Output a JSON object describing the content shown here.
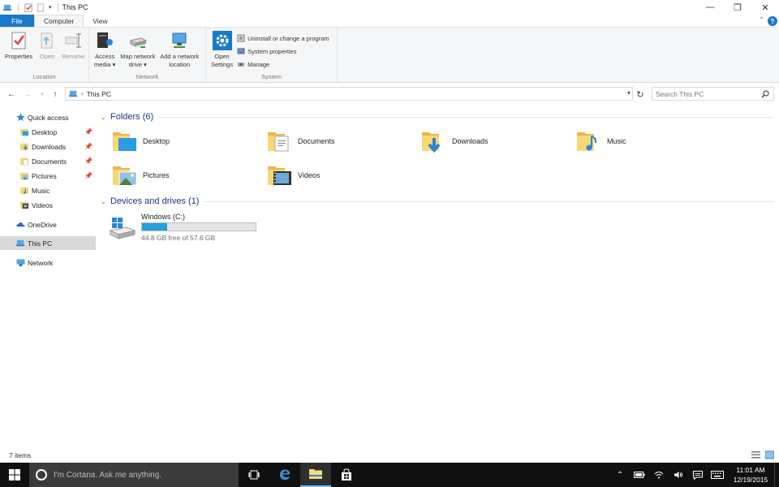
{
  "window": {
    "title": "This PC"
  },
  "tabs": [
    {
      "label": "File"
    },
    {
      "label": "Computer"
    },
    {
      "label": "View"
    }
  ],
  "ribbon": {
    "location": {
      "label": "Location",
      "properties": "Properties",
      "open": "Open",
      "rename": "Rename"
    },
    "network": {
      "label": "Network",
      "access_media_1": "Access",
      "access_media_2": "media",
      "map_drive_1": "Map network",
      "map_drive_2": "drive",
      "add_location_1": "Add a network",
      "add_location_2": "location"
    },
    "system": {
      "label": "System",
      "open_settings_1": "Open",
      "open_settings_2": "Settings",
      "uninstall": "Uninstall or change a program",
      "system_properties": "System properties",
      "manage": "Manage"
    }
  },
  "address": {
    "path": "This PC"
  },
  "search": {
    "placeholder": "Search This PC"
  },
  "nav": {
    "quick_access": "Quick access",
    "items": [
      {
        "label": "Desktop",
        "pinned": true
      },
      {
        "label": "Downloads",
        "pinned": true
      },
      {
        "label": "Documents",
        "pinned": true
      },
      {
        "label": "Pictures",
        "pinned": true
      },
      {
        "label": "Music",
        "pinned": false
      },
      {
        "label": "Videos",
        "pinned": false
      }
    ],
    "onedrive": "OneDrive",
    "this_pc": "This PC",
    "network": "Network"
  },
  "content": {
    "folders_header": "Folders (6)",
    "folders": [
      {
        "label": "Desktop"
      },
      {
        "label": "Documents"
      },
      {
        "label": "Downloads"
      },
      {
        "label": "Music"
      },
      {
        "label": "Pictures"
      },
      {
        "label": "Videos"
      }
    ],
    "devices_header": "Devices and drives (1)",
    "drive": {
      "name": "Windows (C:)",
      "free_text": "44.8 GB free of 57.6 GB",
      "used_fraction": 0.222
    }
  },
  "status": {
    "items": "7 items"
  },
  "taskbar": {
    "cortana_placeholder": "I'm Cortana. Ask me anything.",
    "time": "11:01 AM",
    "date": "12/19/2015"
  },
  "colors": {
    "accent": "#1979ca",
    "folder": "#f8d775",
    "header_text": "#1e3287",
    "drive_bar": "#26a0da"
  }
}
